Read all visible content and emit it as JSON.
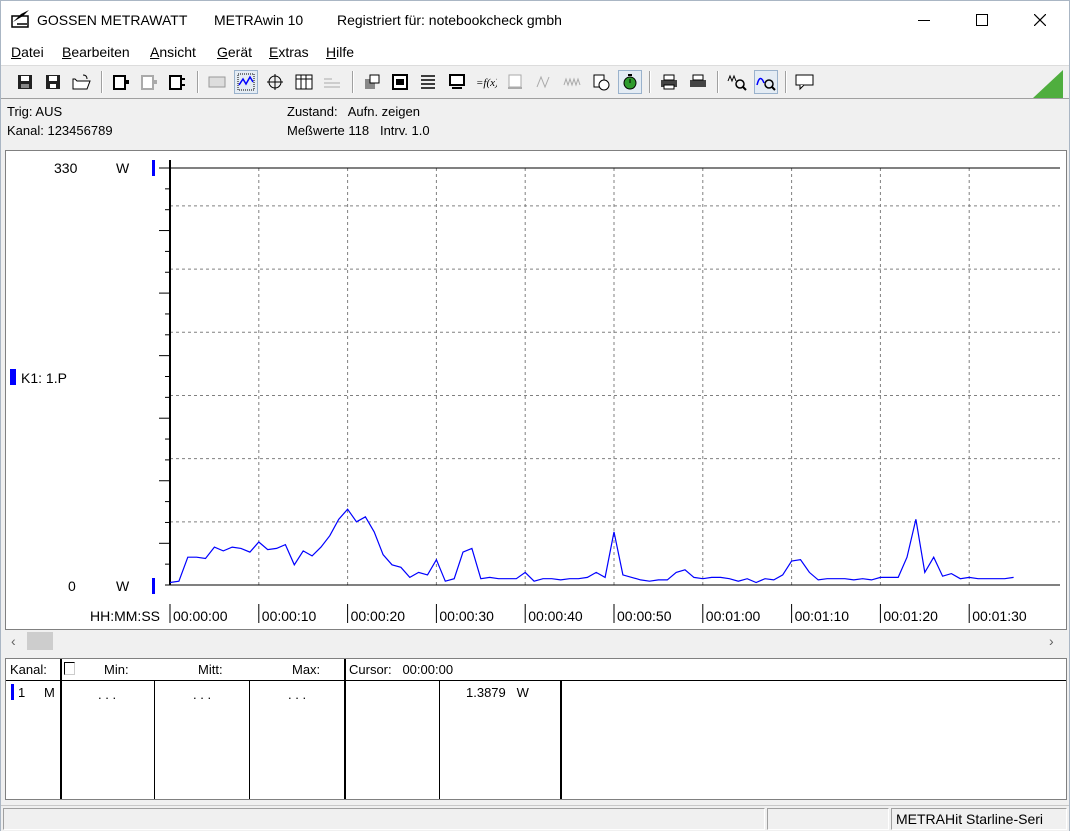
{
  "window": {
    "brand": "GOSSEN METRAWATT",
    "app": "METRAwin 10",
    "registration": "Registriert für: notebookcheck gmbh"
  },
  "menu": [
    {
      "mnemonic": "D",
      "rest": "atei"
    },
    {
      "mnemonic": "B",
      "rest": "earbeiten"
    },
    {
      "mnemonic": "A",
      "rest": "nsicht"
    },
    {
      "mnemonic": "G",
      "rest": "erät"
    },
    {
      "mnemonic": "E",
      "rest": "xtras"
    },
    {
      "mnemonic": "H",
      "rest": "ilfe"
    }
  ],
  "toolbar": {
    "icons": [
      "save-icon",
      "save-as-icon",
      "open-icon",
      "device-icon",
      "device-disabled-icon",
      "device-config-icon",
      "display-icon",
      "line-view-icon",
      "crosshair-icon",
      "table-icon",
      "list-view-icon",
      "export-icon",
      "import-icon",
      "settings-list-icon",
      "monitor-icon",
      "formula-icon",
      "meter-icon",
      "signal-icon",
      "wave-icon",
      "timer-icon",
      "stopwatch-icon",
      "print-icon",
      "print-setup-icon",
      "zoom-wave-icon",
      "zoom-curve-icon",
      "message-icon"
    ]
  },
  "info": {
    "trig": "Trig: AUS",
    "kanal": "Kanal: 123456789",
    "zustand": "Zustand:   Aufn. zeigen",
    "messwerte": "Meßwerte 118   Intrv. 1.0"
  },
  "chart_data": {
    "type": "line",
    "y_max_label": "330",
    "y_min_label": "0",
    "y_unit": "W",
    "channel_label": "K1: 1.P",
    "x_axis_label": "HH:MM:SS",
    "x_ticks": [
      "00:00:00",
      "00:00:10",
      "00:00:20",
      "00:00:30",
      "00:00:40",
      "00:00:50",
      "00:01:00",
      "00:01:10",
      "00:01:20",
      "00:01:30"
    ],
    "ylim": [
      0,
      330
    ],
    "xlim": [
      0,
      100
    ],
    "grid": true,
    "line_color": "#0000ff",
    "series": [
      {
        "x": [
          0,
          1,
          2,
          3,
          4,
          5,
          6,
          7,
          8,
          9,
          10,
          11,
          12,
          13,
          14,
          15,
          16,
          17,
          18,
          19,
          20,
          21,
          22,
          23,
          24,
          25,
          26,
          27,
          28,
          29,
          30,
          31,
          32,
          33,
          34,
          35,
          36,
          37,
          38,
          39,
          40,
          41,
          42,
          43,
          44,
          45,
          46,
          47,
          48,
          49,
          50,
          51,
          52,
          53,
          54,
          55,
          56,
          57,
          58,
          59,
          60,
          61,
          62,
          63,
          64,
          65,
          66,
          67,
          68,
          69,
          70,
          71,
          72,
          73,
          74,
          75,
          76,
          77,
          78,
          79,
          80,
          81,
          82,
          83,
          84,
          85,
          86,
          87,
          88,
          89,
          90,
          91,
          92,
          93,
          94,
          95
        ],
        "values": [
          2,
          3,
          22,
          22,
          21,
          30,
          27,
          30,
          29,
          26,
          34,
          28,
          29,
          32,
          16,
          27,
          23,
          30,
          39,
          52,
          60,
          50,
          54,
          42,
          24,
          16,
          14,
          6,
          10,
          8,
          20,
          3,
          5,
          26,
          29,
          5,
          6,
          5,
          5,
          5,
          10,
          3,
          5,
          5,
          4,
          5,
          5,
          6,
          10,
          6,
          42,
          8,
          6,
          4,
          3,
          4,
          4,
          10,
          12,
          6,
          5,
          6,
          6,
          5,
          3,
          5,
          2,
          5,
          4,
          8,
          19,
          20,
          10,
          4,
          5,
          5,
          5,
          4,
          5,
          4,
          6,
          6,
          6,
          22,
          52,
          10,
          22,
          7,
          9,
          5,
          6,
          5,
          5,
          5,
          5,
          6
        ]
      }
    ]
  },
  "scrollbar": {
    "left": "‹",
    "right": "›"
  },
  "measure_table": {
    "headers": {
      "kanal": "Kanal:",
      "min": "Min:",
      "mitt": "Mitt:",
      "max": "Max:",
      "cursor": "Cursor:   00:00:00"
    },
    "row": {
      "channel": "1",
      "mode": "M",
      "min": ". . .",
      "mitt": ". . .",
      "max": ". . .",
      "cursor_value": "1.3879   W"
    }
  },
  "statusbar": {
    "device": "METRAHit Starline-Seri"
  }
}
